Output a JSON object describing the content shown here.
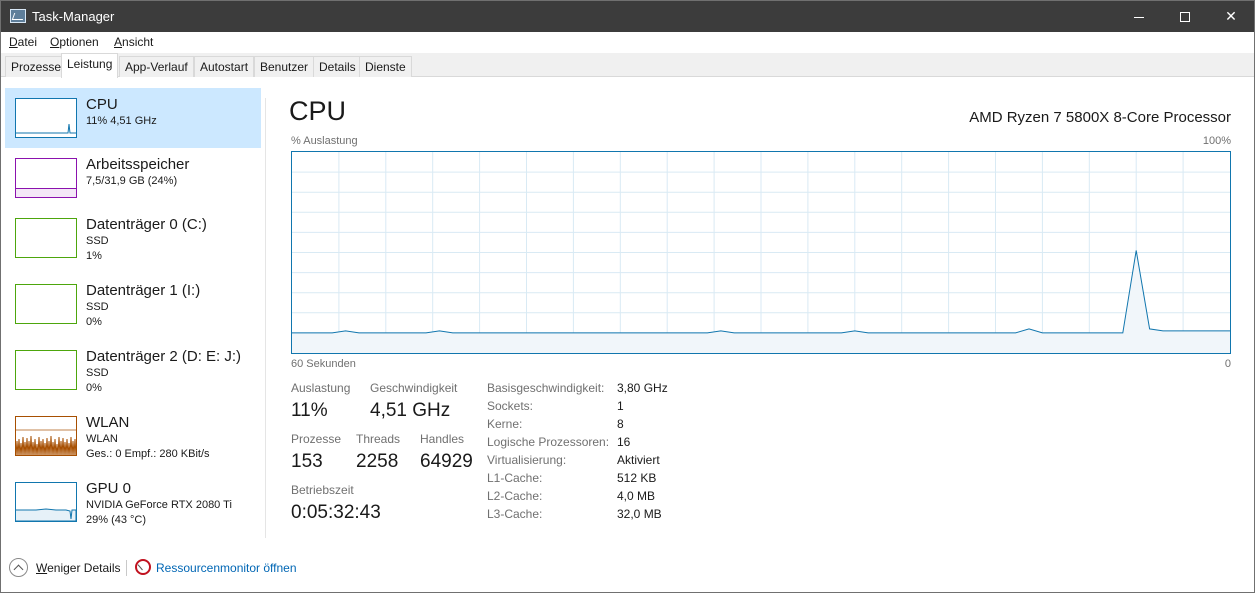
{
  "window": {
    "title": "Task-Manager"
  },
  "menu": [
    "Datei",
    "Optionen",
    "Ansicht"
  ],
  "tabs": [
    "Prozesse",
    "Leistung",
    "App-Verlauf",
    "Autostart",
    "Benutzer",
    "Details",
    "Dienste"
  ],
  "active_tab": "Leistung",
  "sidebar": {
    "items": [
      {
        "name": "CPU",
        "line1": "11% 4,51 GHz",
        "line2": "",
        "selected": true
      },
      {
        "name": "Arbeitsspeicher",
        "line1": "7,5/31,9 GB (24%)",
        "line2": ""
      },
      {
        "name": "Datenträger 0 (C:)",
        "line1": "SSD",
        "line2": "1%"
      },
      {
        "name": "Datenträger 1 (I:)",
        "line1": "SSD",
        "line2": "0%"
      },
      {
        "name": "Datenträger 2 (D: E: J:)",
        "line1": "SSD",
        "line2": "0%"
      },
      {
        "name": "WLAN",
        "line1": "WLAN",
        "line2": "Ges.: 0 Empf.: 280 KBit/s"
      },
      {
        "name": "GPU 0",
        "line1": "NVIDIA GeForce RTX 2080 Ti",
        "line2": "29% (43 °C)"
      }
    ],
    "levels": {
      "cpu": 0.11,
      "memory": 0.24,
      "disk0": 0.01,
      "disk1": 0.0,
      "disk2": 0.0,
      "gpu": 0.29
    }
  },
  "main": {
    "title": "CPU",
    "processor": "AMD Ryzen 7 5800X 8-Core Processor",
    "graph_label_left": "% Auslastung",
    "graph_label_right": "100%",
    "time_left": "60 Sekunden",
    "time_right": "0",
    "stats": {
      "auslastung_label": "Auslastung",
      "auslastung": "11%",
      "geschwindigkeit_label": "Geschwindigkeit",
      "geschwindigkeit": "4,51 GHz",
      "prozesse_label": "Prozesse",
      "prozesse": "153",
      "threads_label": "Threads",
      "threads": "2258",
      "handles_label": "Handles",
      "handles": "64929",
      "betriebszeit_label": "Betriebszeit",
      "betriebszeit": "0:05:32:43"
    },
    "details": [
      {
        "key": "Basisgeschwindigkeit:",
        "value": "3,80 GHz"
      },
      {
        "key": "Sockets:",
        "value": "1"
      },
      {
        "key": "Kerne:",
        "value": "8"
      },
      {
        "key": "Logische Prozessoren:",
        "value": "16"
      },
      {
        "key": "Virtualisierung:",
        "value": "Aktiviert"
      },
      {
        "key": "L1-Cache:",
        "value": "512 KB"
      },
      {
        "key": "L2-Cache:",
        "value": "4,0 MB"
      },
      {
        "key": "L3-Cache:",
        "value": "32,0 MB"
      }
    ],
    "cpu_history_percent": [
      10,
      10,
      10,
      10,
      11,
      10,
      10,
      10,
      10,
      10,
      10,
      11,
      10,
      10,
      10,
      10,
      10,
      10,
      10,
      10,
      10,
      10,
      10,
      10,
      10,
      10,
      10,
      10,
      10,
      10,
      10,
      10,
      11,
      10,
      10,
      10,
      10,
      10,
      10,
      10,
      10,
      10,
      11,
      10,
      10,
      10,
      10,
      10,
      10,
      10,
      10,
      10,
      10,
      10,
      10,
      12,
      10,
      10,
      10,
      10,
      10,
      10,
      10,
      51,
      12,
      11,
      11,
      11,
      11,
      11,
      11
    ],
    "line_color": "#1176ae"
  },
  "footer": {
    "less_details": "Weniger Details",
    "resmon": "Ressourcenmonitor öffnen"
  }
}
